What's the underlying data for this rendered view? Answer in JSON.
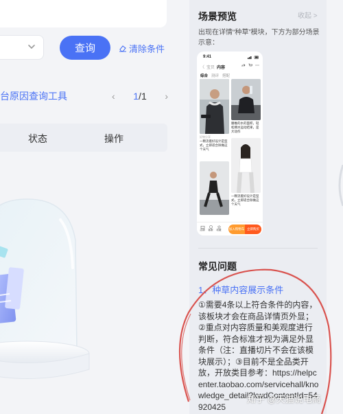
{
  "left": {
    "query_label": "查询",
    "clear_label": "清除条件",
    "tool_title": "台原因查询工具",
    "pager": {
      "prev": "‹",
      "current": "1",
      "separator": "/",
      "total": "1",
      "next": "›"
    },
    "table_headers": [
      "状态",
      "操作"
    ]
  },
  "scene_preview": {
    "title": "场景预览",
    "collapse_label": "收起 >",
    "description": "出现在详情“种草”模块，下方为部分场景示意：",
    "phone": {
      "time": "9:41",
      "nav": [
        "〈",
        "宝贝",
        "内容"
      ],
      "tabs": [
        "综合",
        "测评",
        "搭配"
      ],
      "cards": [
        {
          "caption": ""
        },
        {
          "caption": "腰椎的水的面积，轻松拥水运动结果，是大动作"
        },
        {
          "caption": "一颗流着好设计是型式，立即适合除做这个天气",
          "tag": "好物分享"
        },
        {
          "caption": "一颗流着好设计是型式，立即适合除做这个天气"
        }
      ],
      "bottom_icons": [
        "店铺",
        "客服",
        "收藏"
      ],
      "add_cart": "加入购物车",
      "buy_now": "立即购买"
    }
  },
  "faq": {
    "title": "常见问题",
    "question": "1、种草内容展示条件",
    "answer": "①需要4条以上符合条件的内容，该板块才会在商品详情页外显；②重点对内容质量和美观度进行判断，符合标准才视为满足外显条件（注：直播切片不会在该模块展示）；③目前不是全品类开放，开放类目参考：https://helpcenter.taobao.com/servicehall/knowledge_detail?kwdContentId=54920425"
  },
  "watermark": "知乎 @天猫说电商",
  "colors": {
    "accent": "#4a72f5",
    "annotation": "#d9534f",
    "orange": "#ff9b2f",
    "red_orange": "#ff5a1e"
  }
}
